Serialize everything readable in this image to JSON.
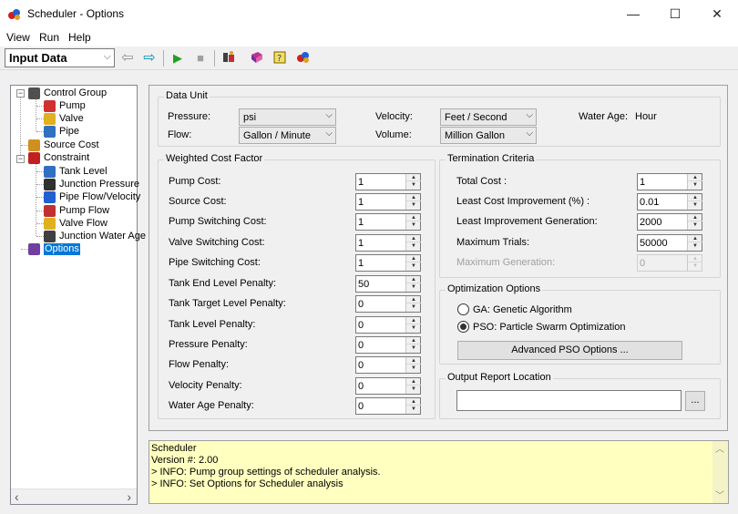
{
  "window": {
    "title": "Scheduler - Options",
    "controls": {
      "minimize": "—",
      "maximize": "☐",
      "close": "✕"
    }
  },
  "menu": [
    "View",
    "Run",
    "Help"
  ],
  "toolbar": {
    "mode_select": "Input Data",
    "icons": [
      "back-arrow-icon",
      "forward-arrow-icon",
      "run-icon",
      "stop-icon",
      "options-icon",
      "book-icon",
      "help-icon",
      "about-icon"
    ]
  },
  "tree": {
    "nodes": [
      {
        "label": "Control Group"
      },
      {
        "label": "Pump"
      },
      {
        "label": "Valve"
      },
      {
        "label": "Pipe"
      },
      {
        "label": "Source Cost"
      },
      {
        "label": "Constraint"
      },
      {
        "label": "Tank Level"
      },
      {
        "label": "Junction Pressure"
      },
      {
        "label": "Pipe Flow/Velocity"
      },
      {
        "label": "Pump Flow"
      },
      {
        "label": "Valve Flow"
      },
      {
        "label": "Junction Water Age"
      },
      {
        "label": "Options"
      }
    ],
    "expand_minus": "−"
  },
  "data_unit": {
    "title": "Data Unit",
    "pressure_label": "Pressure:",
    "pressure_value": "psi",
    "flow_label": "Flow:",
    "flow_value": "Gallon / Minute",
    "velocity_label": "Velocity:",
    "velocity_value": "Feet / Second",
    "volume_label": "Volume:",
    "volume_value": "Million Gallon",
    "water_age_label": "Water Age:",
    "water_age_value": "Hour"
  },
  "weighted": {
    "title": "Weighted Cost Factor",
    "rows": [
      {
        "label": "Pump Cost:",
        "value": "1"
      },
      {
        "label": "Source Cost:",
        "value": "1"
      },
      {
        "label": "Pump Switching Cost:",
        "value": "1"
      },
      {
        "label": "Valve Switching Cost:",
        "value": "1"
      },
      {
        "label": "Pipe Switching Cost:",
        "value": "1"
      },
      {
        "label": "Tank End Level Penalty:",
        "value": "50"
      },
      {
        "label": "Tank Target Level Penalty:",
        "value": "0"
      },
      {
        "label": "Tank Level Penalty:",
        "value": "0"
      },
      {
        "label": "Pressure Penalty:",
        "value": "0"
      },
      {
        "label": "Flow Penalty:",
        "value": "0"
      },
      {
        "label": "Velocity Penalty:",
        "value": "0"
      },
      {
        "label": "Water Age Penalty:",
        "value": "0"
      }
    ]
  },
  "termination": {
    "title": "Termination Criteria",
    "rows": [
      {
        "label": "Total Cost :",
        "value": "1"
      },
      {
        "label": "Least Cost Improvement (%) :",
        "value": "0.01"
      },
      {
        "label": "Least Improvement Generation:",
        "value": "2000"
      },
      {
        "label": "Maximum Trials:",
        "value": "50000"
      },
      {
        "label": "Maximum Generation:",
        "value": "0"
      }
    ]
  },
  "optimization": {
    "title": "Optimization Options",
    "ga_label": "GA:  Genetic Algorithm",
    "pso_label": "PSO: Particle Swarm Optimization",
    "advanced_button": "Advanced PSO Options ..."
  },
  "output": {
    "title": "Output Report Location",
    "path_value": "",
    "browse_button": "..."
  },
  "log": {
    "lines": [
      "Scheduler",
      "Version #: 2.00",
      "> INFO: Pump group settings of scheduler analysis.",
      "> INFO: Set Options for Scheduler analysis"
    ]
  },
  "glyphs": {
    "dropdown": "⌵",
    "spin_up": "▲",
    "spin_down": "▼",
    "scroll_left": "‹",
    "scroll_right": "›",
    "scroll_up": "︿",
    "scroll_down": "﹀",
    "back": "⇦",
    "forward": "⇨",
    "run": "▶",
    "stop": "■"
  }
}
